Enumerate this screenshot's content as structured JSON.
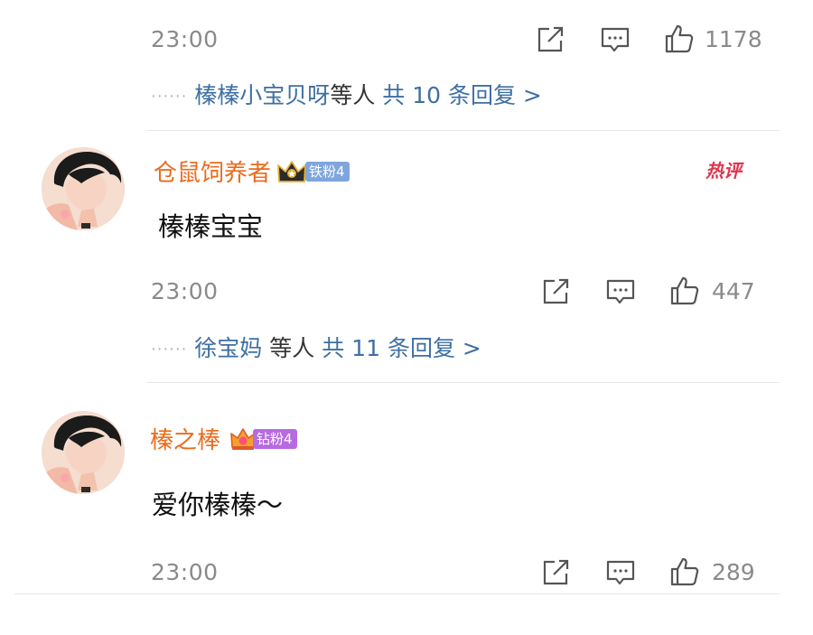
{
  "comment1": {
    "time": "23:00",
    "likes": "1178",
    "replies": {
      "names": "榛榛小宝贝呀",
      "suffix": "等人",
      "total": "共 10 条回复 >"
    }
  },
  "comment2": {
    "username": "仓鼠饲养者",
    "badge_label": "铁粉4",
    "hot_label": "热评",
    "content": "榛榛宝宝",
    "time": "23:00",
    "likes": "447",
    "replies": {
      "names": "徐宝妈",
      "suffix": "等人",
      "total": "共 11 条回复 >"
    }
  },
  "comment3": {
    "username": "榛之棒",
    "badge_label": "钻粉4",
    "content": "爱你榛榛～",
    "time": "23:00",
    "likes": "289"
  },
  "colors": {
    "username": "#ec6b1c",
    "reply_link": "#3e6fa3",
    "meta_grey": "#8a8a8a",
    "iron_badge": "#7fa5dc",
    "diamond_badge": "#b76be0",
    "hot": "#e0334b"
  },
  "icons": [
    "share-icon",
    "comment-icon",
    "thumbs-up-icon",
    "crown-icon",
    "avatar"
  ]
}
